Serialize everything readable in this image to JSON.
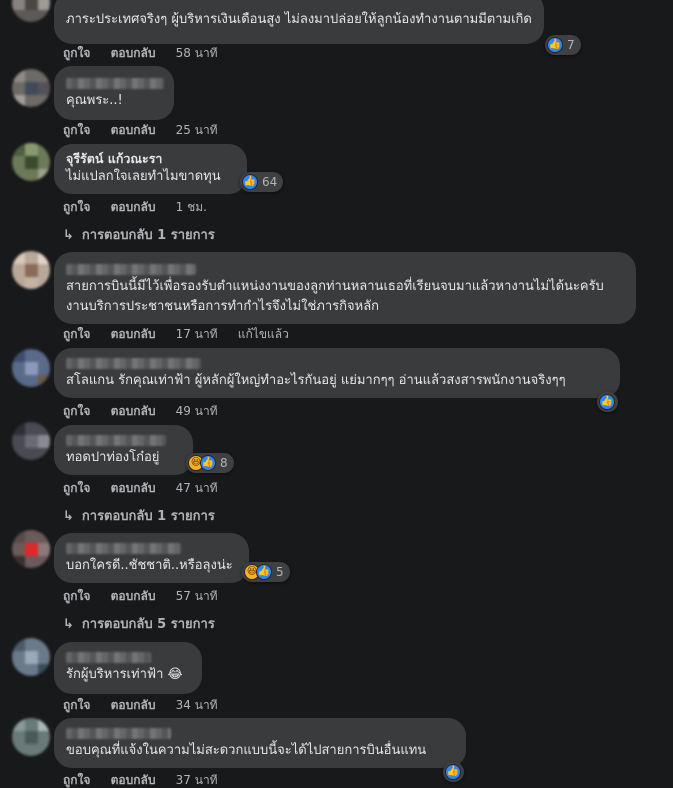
{
  "actions": {
    "like": "ถูกใจ",
    "reply": "ตอบกลับ",
    "edited": "แก้ไขแล้ว"
  },
  "comments": [
    {
      "text": "ภาระประเทศจริงๆ ผู้บริหารเงินเดือนสูง ไม่ลงมาปล่อยให้ลูกน้องทำงานตามมีตามเกิด",
      "time": "58 นาที",
      "reaction_count": "7",
      "reactions": [
        "like-icon"
      ]
    },
    {
      "name": "",
      "text": "คุณพระ..!",
      "time": "25 นาที"
    },
    {
      "name": "จุรีรัตน์ แก้วณะรา",
      "text": "ไม่แปลกใจเลยทำไมขาดทุน",
      "time": "1 ชม.",
      "reaction_count": "64",
      "reactions": [
        "like-icon"
      ],
      "replies": "การตอบกลับ 1 รายการ"
    },
    {
      "name": "",
      "text": "สายการบินนี้มีไว้เพื่อรองรับตำแหน่งงานของลูกท่านหลานเธอที่เรียนจบมาแล้วหางานไม่ได้นะครับ งานบริการประชาชนหรือการทำกำไรจึงไม่ใช่ภารกิจหลัก",
      "time": "17 นาที",
      "edited": true
    },
    {
      "name": "",
      "text": "สโลแกน รักคุณเท่าฟ้า ผู้หลักผู้ใหญ่ทำอะไรกันอยู่ แย่มากๆๆ อ่านแล้วสงสารพนักงานจริงๆๆ",
      "time": "49 นาที",
      "reactions": [
        "like-icon"
      ]
    },
    {
      "name": "",
      "text": "ทอดปาท่องโก๋อยู่",
      "time": "47 นาที",
      "reaction_count": "8",
      "reactions": [
        "haha-icon",
        "like-icon"
      ],
      "replies": "การตอบกลับ 1 รายการ"
    },
    {
      "name": "",
      "text": "บอกใครดี..ชัชชาติ..หรือลุงน่ะ",
      "time": "57 นาที",
      "reaction_count": "5",
      "reactions": [
        "haha-icon",
        "like-icon"
      ],
      "replies": "การตอบกลับ 5 รายการ"
    },
    {
      "name": "",
      "text": "รักผู้บริหารเท่าฟ้า 😂",
      "time": "34 นาที"
    },
    {
      "name": "",
      "text": "ขอบคุณที่แจ้งในความไม่สะดวกแบบนี้จะได้ไปสายการบินอื่นแทน",
      "time": "37 นาที",
      "reactions": [
        "like-icon"
      ]
    }
  ],
  "colors": {
    "background": "#18191a",
    "bubble": "#3a3b3c",
    "secondary_text": "#b0b3b8",
    "like_blue": "#2d88ff",
    "haha_yellow": "#f7b125"
  }
}
